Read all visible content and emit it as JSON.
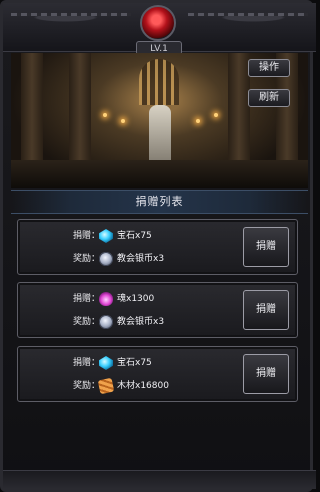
{
  "header": {
    "level_label": "LV.1"
  },
  "buttons": {
    "operate": "操作",
    "refresh": "刷新"
  },
  "panel": {
    "title": "捐赠列表"
  },
  "donations": [
    {
      "donate_label": "捐赠：",
      "donate_icon": "gem-icon",
      "donate_text": "宝石x75",
      "reward_label": "奖励：",
      "reward_icon": "church-silver-coin-icon",
      "reward_text": "教会银币x3",
      "button_label": "捐赠"
    },
    {
      "donate_label": "捐赠：",
      "donate_icon": "soul-icon",
      "donate_text": "魂x1300",
      "reward_label": "奖励：",
      "reward_icon": "church-silver-coin-icon",
      "reward_text": "教会银币x3",
      "button_label": "捐赠"
    },
    {
      "donate_label": "捐赠：",
      "donate_icon": "gem-icon",
      "donate_text": "宝石x75",
      "reward_label": "奖励：",
      "reward_icon": "wood-icon",
      "reward_text": "木材x16800",
      "button_label": "捐赠"
    }
  ],
  "colors": {
    "panel_bg": "#1a1a1e",
    "title_bar": "#24344a",
    "gem_red": "#b3121b"
  }
}
